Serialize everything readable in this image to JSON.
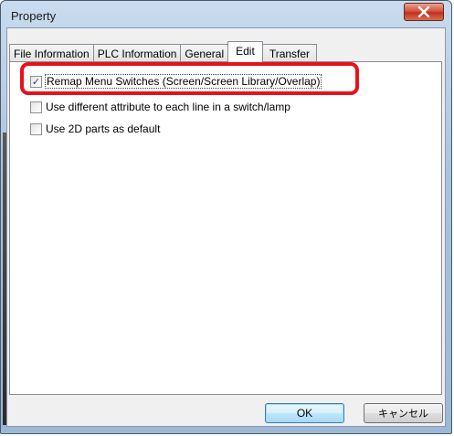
{
  "window": {
    "title": "Property"
  },
  "tabs": [
    {
      "label": "File Information",
      "active": false
    },
    {
      "label": "PLC Information",
      "active": false
    },
    {
      "label": "General",
      "active": false
    },
    {
      "label": "Edit",
      "active": true
    },
    {
      "label": "Transfer",
      "active": false
    }
  ],
  "options": [
    {
      "label": "Remap Menu Switches (Screen/Screen Library/Overlap)",
      "checked": true
    },
    {
      "label": "Use different attribute to each line in a switch/lamp",
      "checked": false
    },
    {
      "label": "Use 2D parts as default",
      "checked": false
    }
  ],
  "buttons": {
    "ok": "OK",
    "cancel": "キャンセル"
  },
  "icons": {
    "close": "close-icon",
    "check": "check-icon"
  },
  "colors": {
    "highlight": "#e8111b",
    "close_button": "#c0301d",
    "check": "#2a3c8a"
  }
}
